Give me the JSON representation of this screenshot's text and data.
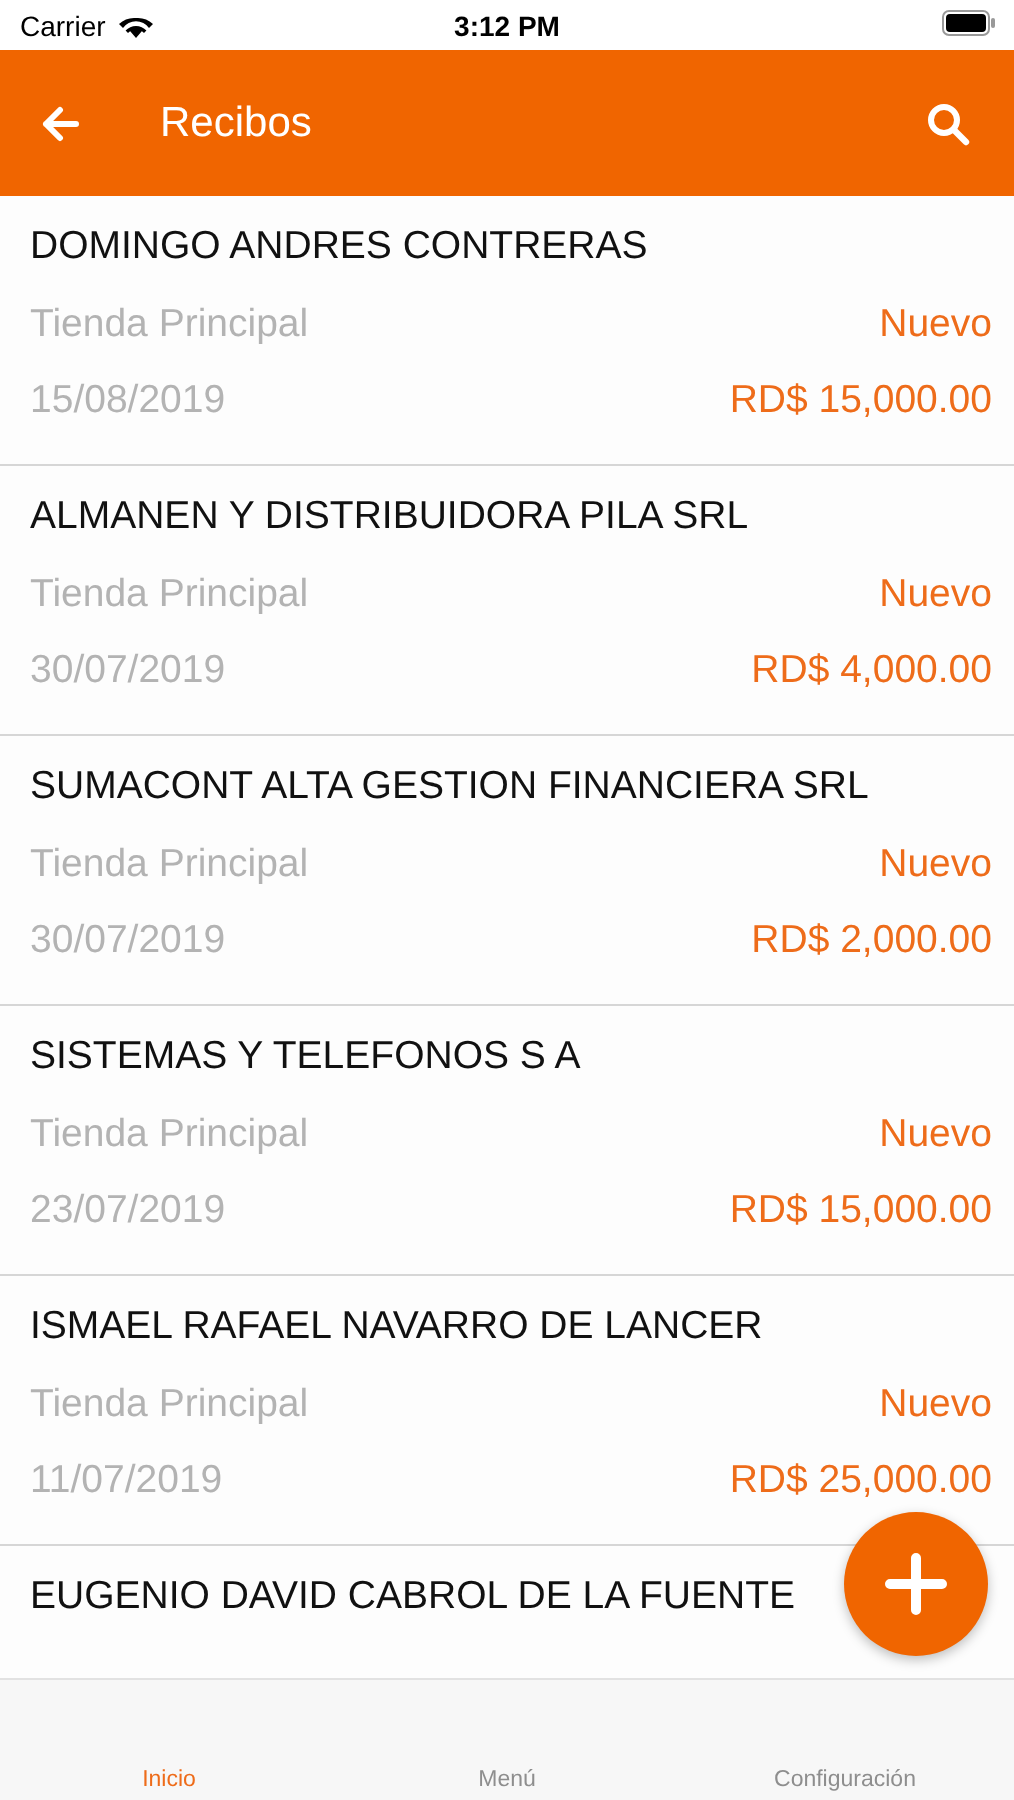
{
  "status_bar": {
    "carrier": "Carrier",
    "time": "3:12 PM"
  },
  "header": {
    "title": "Recibos"
  },
  "receipts": [
    {
      "name": "DOMINGO ANDRES CONTRERAS",
      "store": "Tienda Principal",
      "status": "Nuevo",
      "date": "15/08/2019",
      "amount": "RD$ 15,000.00"
    },
    {
      "name": "ALMANEN Y DISTRIBUIDORA PILA SRL",
      "store": "Tienda Principal",
      "status": "Nuevo",
      "date": "30/07/2019",
      "amount": "RD$ 4,000.00"
    },
    {
      "name": "SUMACONT ALTA GESTION FINANCIERA SRL",
      "store": "Tienda Principal",
      "status": "Nuevo",
      "date": "30/07/2019",
      "amount": "RD$ 2,000.00"
    },
    {
      "name": "SISTEMAS Y TELEFONOS S A",
      "store": "Tienda Principal",
      "status": "Nuevo",
      "date": "23/07/2019",
      "amount": "RD$ 15,000.00"
    },
    {
      "name": "ISMAEL RAFAEL NAVARRO DE LANCER",
      "store": "Tienda Principal",
      "status": "Nuevo",
      "date": "11/07/2019",
      "amount": "RD$ 25,000.00"
    },
    {
      "name": "EUGENIO DAVID CABROL DE LA FUENTE"
    }
  ],
  "tabs": [
    {
      "label": "Inicio",
      "selected": true
    },
    {
      "label": "Menú",
      "selected": false
    },
    {
      "label": "Configuración",
      "selected": false
    }
  ]
}
